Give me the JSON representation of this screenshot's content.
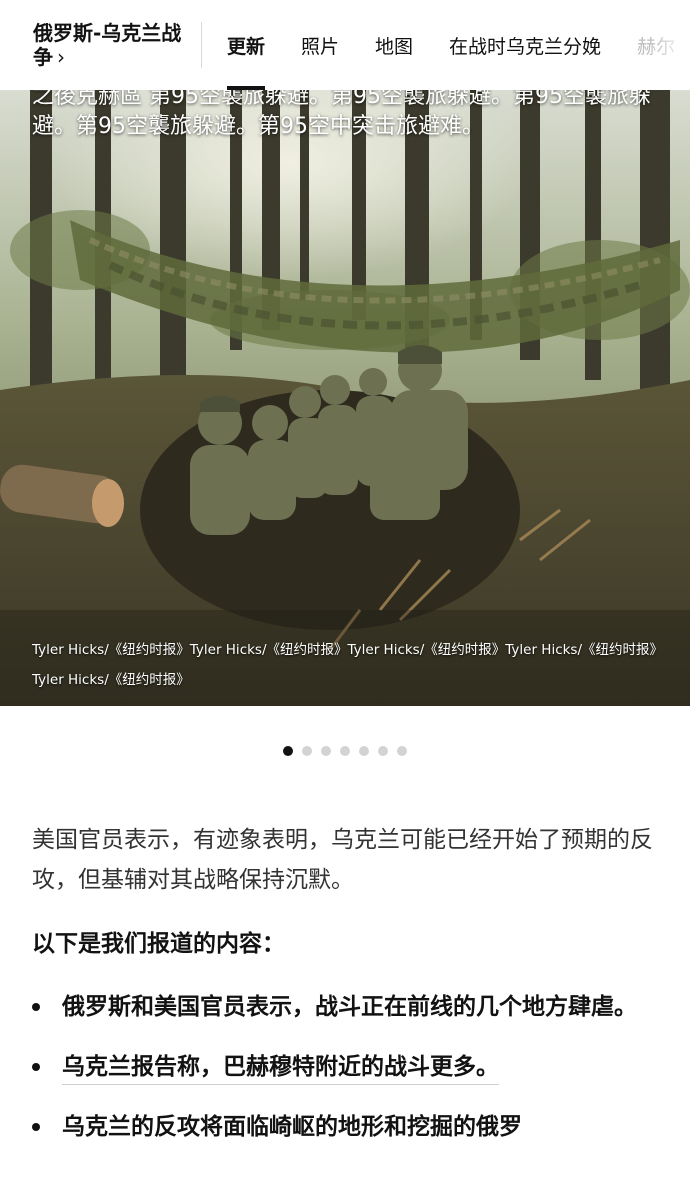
{
  "header": {
    "section_title": "俄罗斯-乌克兰战争",
    "section_chevron": "›",
    "tabs": [
      {
        "label": "更新",
        "active": true
      },
      {
        "label": "照片",
        "active": false
      },
      {
        "label": "地图",
        "active": false
      },
      {
        "label": "在战时乌克兰分娩",
        "active": false
      },
      {
        "label": "赫尔",
        "active": false
      }
    ]
  },
  "photo": {
    "caption_overlay": "之後克赫區 第95空襲旅躲避。第95空襲旅躲避。第95空襲旅躲避。第95空襲旅躲避。第95空中突击旅避难。",
    "credit": "Tyler Hicks/《纽约时报》Tyler Hicks/《纽约时报》Tyler Hicks/《纽约时报》Tyler Hicks/《纽约时报》Tyler Hicks/《纽约时报》"
  },
  "carousel": {
    "total": 7,
    "active_index": 0
  },
  "article": {
    "lede": "美国官员表示，有迹象表明，乌克兰可能已经开始了预期的反攻，但基辅对其战略保持沉默。",
    "subhead": "以下是我们报道的内容：",
    "bullets": [
      {
        "text": "俄罗斯和美国官员表示，战斗正在前线的几个地方肆虐。",
        "is_link": false
      },
      {
        "text": "乌克兰报告称，巴赫穆特附近的战斗更多。",
        "is_link": true
      },
      {
        "text": "乌克兰的反攻将面临崎岖的地形和挖掘的俄罗",
        "is_link": false
      }
    ]
  },
  "colors": {
    "text": "#121212",
    "dot_inactive": "#d3d3d3",
    "dot_active": "#121212",
    "divider": "#d9d9d9"
  }
}
